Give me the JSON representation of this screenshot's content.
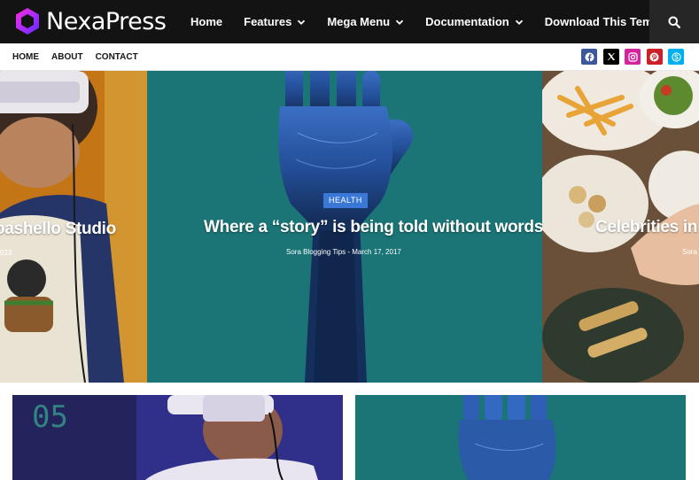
{
  "brand": {
    "name": "NexaPress"
  },
  "nav": {
    "items": [
      {
        "label": "Home",
        "dropdown": false
      },
      {
        "label": "Features",
        "dropdown": true
      },
      {
        "label": "Mega Menu",
        "dropdown": true
      },
      {
        "label": "Documentation",
        "dropdown": true
      },
      {
        "label": "Download This Template",
        "dropdown": false
      }
    ],
    "search_icon": "search-icon"
  },
  "subnav": {
    "items": [
      "HOME",
      "ABOUT",
      "CONTACT"
    ]
  },
  "socials": [
    {
      "name": "facebook-icon",
      "color": "#3b5998"
    },
    {
      "name": "x-twitter-icon",
      "color": "#000000"
    },
    {
      "name": "instagram-icon",
      "color": "#d6249f"
    },
    {
      "name": "pinterest-icon",
      "color": "#cb2027"
    },
    {
      "name": "skype-icon",
      "color": "#00aff0"
    }
  ],
  "hero": {
    "slides": [
      {
        "title": "oashello Studio",
        "meta": "023"
      },
      {
        "category": "HEALTH",
        "title": "Where a “story” is being told without words",
        "meta": "Sora Blogging Tips - March 17, 2017"
      },
      {
        "title": "Celebrities in th",
        "meta": "Sora"
      }
    ]
  },
  "colors": {
    "header_bg": "#131313",
    "accent": "#3a78d8",
    "teal": "#1b7476"
  }
}
